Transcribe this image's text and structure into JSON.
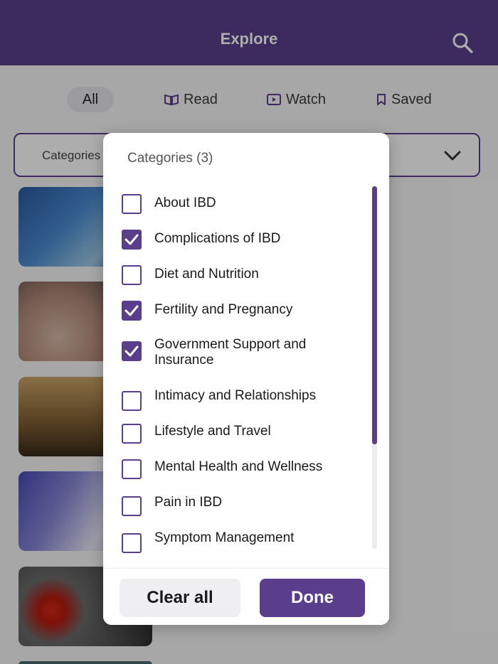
{
  "header": {
    "title": "Explore"
  },
  "tabs": [
    {
      "label": "All",
      "icon": "none",
      "selected": true
    },
    {
      "label": "Read",
      "icon": "book-icon"
    },
    {
      "label": "Watch",
      "icon": "play-icon"
    },
    {
      "label": "Saved",
      "icon": "bookmark-icon"
    }
  ],
  "category_select": {
    "label": "Categories"
  },
  "modal": {
    "title": "Categories (3)",
    "options": [
      {
        "label": "About IBD",
        "checked": false
      },
      {
        "label": "Complications of IBD",
        "checked": true
      },
      {
        "label": "Diet and Nutrition",
        "checked": false
      },
      {
        "label": "Fertility and Pregnancy",
        "checked": true
      },
      {
        "label": "Government Support and Insurance",
        "checked": true
      },
      {
        "label": "Intimacy and Relationships",
        "checked": false
      },
      {
        "label": "Lifestyle and Travel",
        "checked": false
      },
      {
        "label": "Mental Health and Wellness",
        "checked": false
      },
      {
        "label": "Pain in IBD",
        "checked": false
      },
      {
        "label": "Symptom Management",
        "checked": false
      }
    ],
    "clear_label": "Clear all",
    "done_label": "Done"
  },
  "colors": {
    "brand": "#5a3e8c",
    "header_bg": "#5a3e8c"
  }
}
